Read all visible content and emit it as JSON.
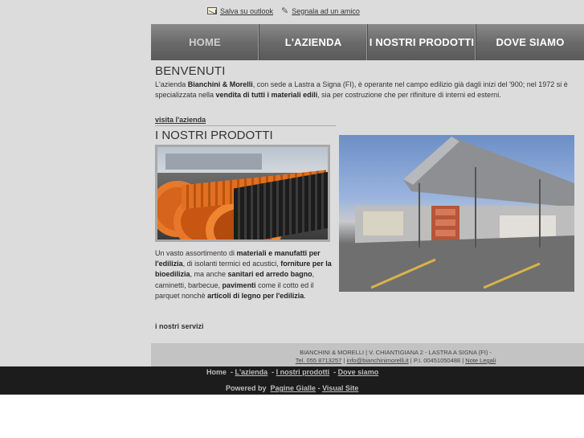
{
  "topbar": {
    "save_outlook": "Salva su outlook",
    "tell_friend": "Segnala ad un amico"
  },
  "nav": {
    "items": [
      {
        "label": "HOME"
      },
      {
        "label": "L'AZIENDA"
      },
      {
        "label": "I NOSTRI PRODOTTI"
      },
      {
        "label": "DOVE SIAMO"
      }
    ]
  },
  "welcome": {
    "title": "BENVENUTI",
    "p1": "L'azienda ",
    "company": "Bianchini & Morelli",
    "p2": ", con sede a Lastra a Signa (FI), è operante nel campo edilizio già dagli inizi del '900; nel 1972 si è specializzata nella ",
    "highlight": "vendita di tutti i materiali edili",
    "p3": ", sia per costruzione che per rifiniture di interni ed esterni.",
    "link": "visita l'azienda"
  },
  "products": {
    "title": "I NOSTRI PRODOTTI",
    "t1": "Un vasto assortimento di ",
    "b1": "materiali e manufatti per l'edilizia",
    "t2": ", di isolanti termici ed acustici, ",
    "b2": "forniture per la bioedilizia",
    "t3": ", ma anche ",
    "b3": "sanitari ed arredo bagno",
    "t4": ", caminetti, barbecue, ",
    "b4": "pavimenti",
    "t5": " come il cotto ed il parquet nonchè ",
    "b5": "articoli di legno per l'edilizia",
    "t6": ".",
    "services_link": "i nostri servizi"
  },
  "footer": {
    "address": "BIANCHINI & MORELLI | V. CHIANTIGIANA 2 - LASTRA A SIGNA (FI) -",
    "tel": "Tel. 055 8713257",
    "email": "info@bianchinimorelli.it",
    "piva": "P.I. 00451050488",
    "legal": "Note Legali"
  },
  "bottom": {
    "home": "Home",
    "azienda": "L'azienda",
    "prodotti": "I nostri prodotti",
    "dove": "Dove siamo",
    "powered": "Powered by",
    "pagine_gialle": "Pagine Gialle",
    "visual_site": "Visual Site"
  }
}
